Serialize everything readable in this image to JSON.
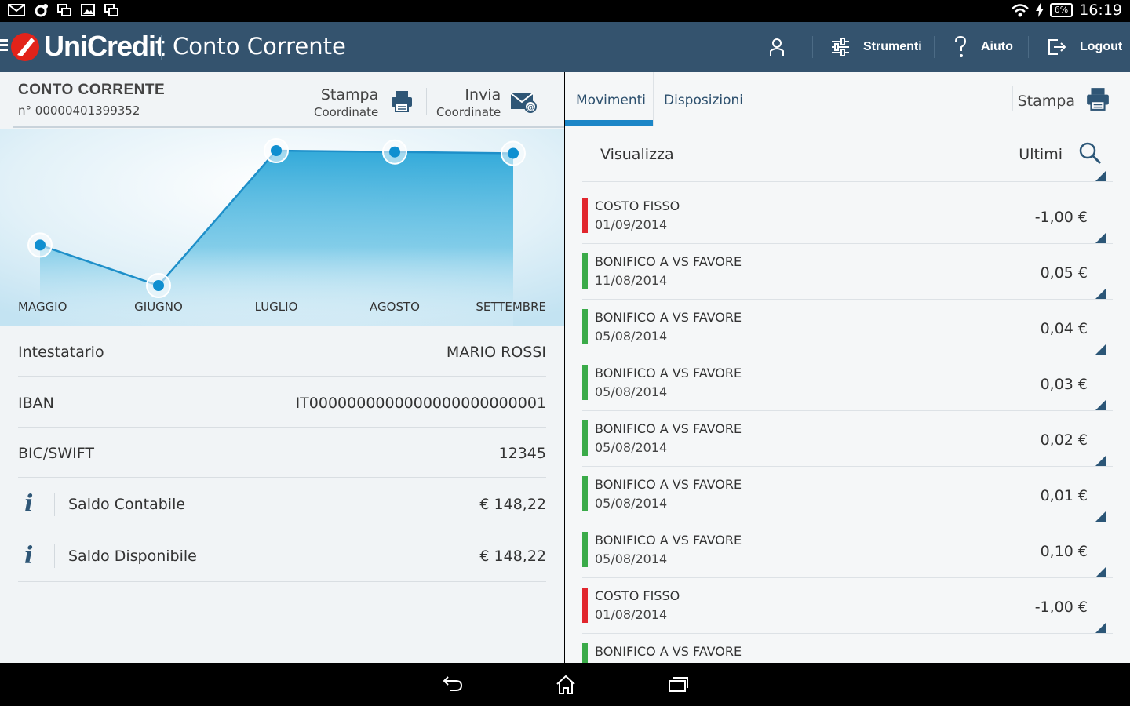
{
  "statusbar": {
    "time": "16:19",
    "battery": "6%"
  },
  "header": {
    "logo": "UniCredit",
    "title": "Conto Corrente",
    "buttons": [
      {
        "label": "Strumenti"
      },
      {
        "label": "Aiuto"
      },
      {
        "label": "Logout"
      }
    ]
  },
  "account": {
    "title": "CONTO CORRENTE",
    "number": "n° 00000401399352",
    "actions": {
      "print": {
        "line1": "Stampa",
        "line2": "Coordinate"
      },
      "send": {
        "line1": "Invia",
        "line2": "Coordinate"
      }
    }
  },
  "chart_data": {
    "type": "area",
    "categories": [
      "MAGGIO",
      "GIUGNO",
      "LUGLIO",
      "AGOSTO",
      "SETTEMBRE"
    ],
    "values": [
      0.3,
      0.0,
      1.0,
      0.99,
      0.98
    ],
    "ylim": [
      0,
      1
    ],
    "grid": false
  },
  "details": [
    {
      "label": "Intestatario",
      "value": "MARIO ROSSI"
    },
    {
      "label": "IBAN",
      "value": "IT0000000000000000000000001"
    },
    {
      "label": "BIC/SWIFT",
      "value": "12345"
    },
    {
      "label": "Saldo Contabile",
      "value": "€ 148,22"
    },
    {
      "label": "Saldo Disponibile",
      "value": "€ 148,22"
    }
  ],
  "tabs": [
    {
      "label": "Movimenti",
      "active": true
    },
    {
      "label": "Disposizioni",
      "active": false
    }
  ],
  "print_label": "Stampa",
  "filter": {
    "label": "Visualizza",
    "value": "Ultimi"
  },
  "colors": {
    "debit": "#e1262d",
    "credit": "#3aab49",
    "accent": "#1c86c7",
    "header": "#34536e"
  },
  "transactions": [
    {
      "description": "COSTO FISSO",
      "date": "01/09/2014",
      "amount": "-1,00 €",
      "type": "debit"
    },
    {
      "description": "BONIFICO A VS FAVORE",
      "date": "11/08/2014",
      "amount": "0,05 €",
      "type": "credit"
    },
    {
      "description": "BONIFICO A VS FAVORE",
      "date": "05/08/2014",
      "amount": "0,04 €",
      "type": "credit"
    },
    {
      "description": "BONIFICO A VS FAVORE",
      "date": "05/08/2014",
      "amount": "0,03 €",
      "type": "credit"
    },
    {
      "description": "BONIFICO A VS FAVORE",
      "date": "05/08/2014",
      "amount": "0,02 €",
      "type": "credit"
    },
    {
      "description": "BONIFICO A VS FAVORE",
      "date": "05/08/2014",
      "amount": "0,01 €",
      "type": "credit"
    },
    {
      "description": "BONIFICO A VS FAVORE",
      "date": "05/08/2014",
      "amount": "0,10 €",
      "type": "credit"
    },
    {
      "description": "COSTO FISSO",
      "date": "01/08/2014",
      "amount": "-1,00 €",
      "type": "debit"
    },
    {
      "description": "BONIFICO A VS FAVORE",
      "date": "",
      "amount": "",
      "type": "credit"
    }
  ]
}
